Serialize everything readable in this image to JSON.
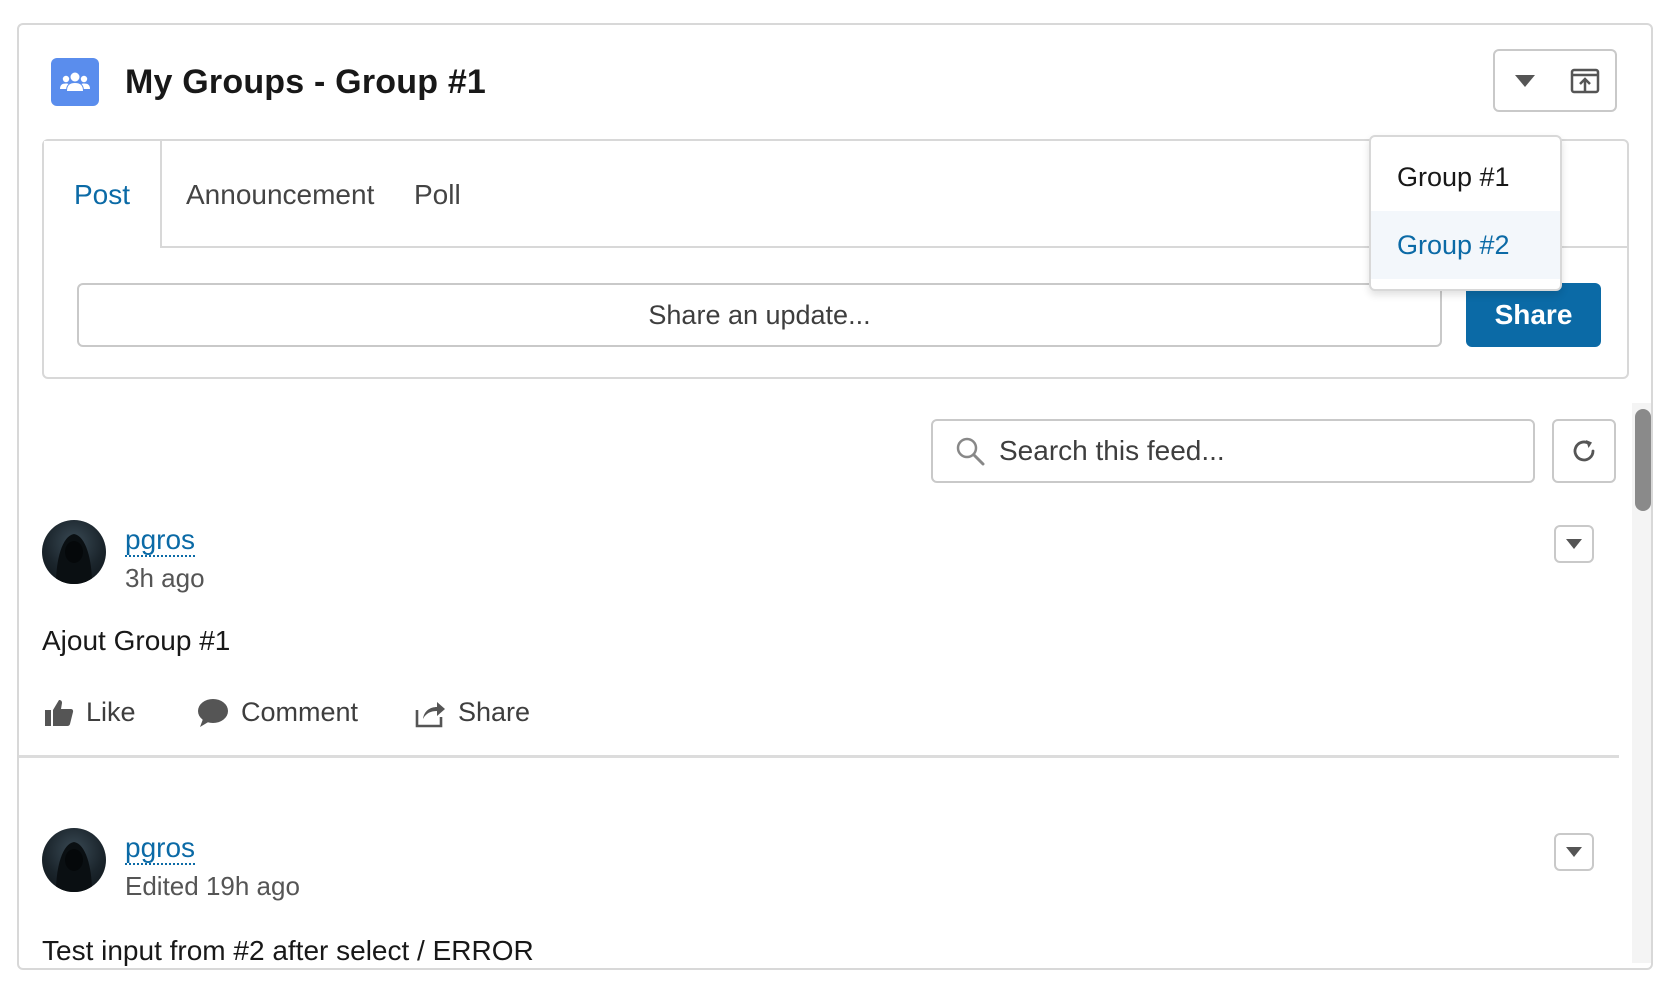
{
  "header": {
    "title": "My Groups - Group #1",
    "icon": "groups-icon",
    "group_select_icon": "chevron-down-icon",
    "popout_icon": "popout-icon"
  },
  "publisher": {
    "tabs": [
      {
        "label": "Post",
        "active": true
      },
      {
        "label": "Announcement",
        "active": false
      },
      {
        "label": "Poll",
        "active": false
      }
    ],
    "share_placeholder": "Share an update...",
    "share_button": "Share"
  },
  "group_dropdown": {
    "options": [
      {
        "label": "Group #1",
        "highlighted": false
      },
      {
        "label": "Group #2",
        "highlighted": true
      }
    ]
  },
  "feed": {
    "search_placeholder": "Search this feed...",
    "posts": [
      {
        "author": "pgros",
        "time": "3h ago",
        "body": "Ajout Group #1",
        "actions": {
          "like": "Like",
          "comment": "Comment",
          "share": "Share"
        }
      },
      {
        "author": "pgros",
        "time": "Edited 19h ago",
        "body": "Test input from #2 after select / ERROR"
      }
    ]
  },
  "colors": {
    "accent": "#0b6aa6",
    "icon_bg": "#5a8ded",
    "border": "#d8d8d8"
  }
}
